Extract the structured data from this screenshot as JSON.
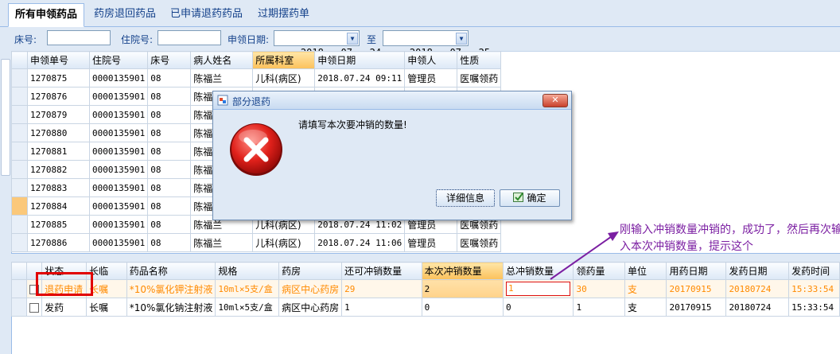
{
  "tabs": [
    "所有申领药品",
    "药房退回药品",
    "已申请退药药品",
    "过期摆药单"
  ],
  "filter": {
    "bed_label": "床号:",
    "bed_value": "",
    "inpatient_label": "住院号:",
    "inpatient_value": "",
    "apply_date_label": "申领日期:",
    "date_from": "2018 - 07 - 24",
    "to_label": "至",
    "date_to": "2018 - 07 - 25"
  },
  "grid1": {
    "columns": [
      "申领单号",
      "住院号",
      "床号",
      "病人姓名",
      "所属科室",
      "申领日期",
      "申领人",
      "性质"
    ],
    "rows": [
      [
        "1270875",
        "0000135901",
        "08",
        "陈福兰",
        "儿科(病区)",
        "2018.07.24 09:11",
        "管理员",
        "医嘱领药"
      ],
      [
        "1270876",
        "0000135901",
        "08",
        "陈福兰",
        "",
        "",
        "",
        ""
      ],
      [
        "1270879",
        "0000135901",
        "08",
        "陈福兰",
        "",
        "",
        "",
        ""
      ],
      [
        "1270880",
        "0000135901",
        "08",
        "陈福兰",
        "",
        "",
        "",
        ""
      ],
      [
        "1270881",
        "0000135901",
        "08",
        "陈福兰",
        "",
        "",
        "",
        ""
      ],
      [
        "1270882",
        "0000135901",
        "08",
        "陈福兰",
        "",
        "",
        "",
        ""
      ],
      [
        "1270883",
        "0000135901",
        "08",
        "陈福兰",
        "",
        "",
        "",
        ""
      ],
      [
        "1270884",
        "0000135901",
        "08",
        "陈福兰",
        "",
        "",
        "",
        ""
      ],
      [
        "1270885",
        "0000135901",
        "08",
        "陈福兰",
        "儿科(病区)",
        "2018.07.24 11:02",
        "管理员",
        "医嘱领药"
      ],
      [
        "1270886",
        "0000135901",
        "08",
        "陈福兰",
        "儿科(病区)",
        "2018.07.24 11:06",
        "管理员",
        "医嘱领药"
      ]
    ]
  },
  "grid2": {
    "columns": [
      "",
      "状态",
      "长临",
      "药品名称",
      "规格",
      "药房",
      "还可冲销数量",
      "本次冲销数量",
      "总冲销数量",
      "领药量",
      "单位",
      "用药日期",
      "发药日期",
      "发药时间"
    ],
    "rows": [
      [
        "",
        "退药申请",
        "长嘱",
        "*10%氯化钾注射液",
        "10ml×5支/盒",
        "病区中心药房",
        "29",
        "2",
        "1",
        "30",
        "支",
        "20170915",
        "20180724",
        "15:33:54"
      ],
      [
        "",
        "发药",
        "长嘱",
        "*10%氯化钠注射液",
        "10ml×5支/盒",
        "病区中心药房",
        "1",
        "0",
        "0",
        "1",
        "支",
        "20170915",
        "20180724",
        "15:33:54"
      ]
    ]
  },
  "dialog": {
    "title": "部分退药",
    "message": "请填写本次要冲销的数量!",
    "details_button": "详细信息",
    "ok_button": "确定",
    "close_button": "✕"
  },
  "annotation": {
    "text": "刚输入冲销数量冲销的，成功了，然后再次输入本次冲销数量，提示这个"
  }
}
